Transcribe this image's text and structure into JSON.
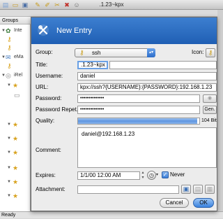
{
  "window": {
    "title": ".1.23~kpx"
  },
  "sidebar": {
    "header": "Groups",
    "items": [
      {
        "label": "Inte"
      },
      {
        "label": ""
      },
      {
        "label": ""
      },
      {
        "label": "eMa"
      },
      {
        "label": ""
      },
      {
        "label": "iRel"
      }
    ]
  },
  "status": {
    "text": "Ready"
  },
  "dialog": {
    "title": "New Entry",
    "group_label": "Group:",
    "group_value": "ssh",
    "icon_label": "Icon:",
    "title_label": "Title:",
    "title_value": ".1.23~kpx",
    "username_label": "Username:",
    "username_value": "daniel",
    "url_label": "URL:",
    "url_value": "kpx://ssh?{USERNAME}:{PASSWORD}:192.168.1.23",
    "password_label": "Password:",
    "password_value": "••••••••••••••",
    "password_repeat_label": "Password Repet.:",
    "password_repeat_value": "••••••••••••••",
    "gen_label": "Gen.",
    "quality_label": "Quality:",
    "quality_value": "104 Bit",
    "quality_fraction": 0.98,
    "comment_label": "Comment:",
    "comment_value": "daniel@192.168.1.23",
    "expires_label": "Expires:",
    "expires_value": "1/1/00 12:00 AM",
    "never_label": "Never",
    "never_checked": true,
    "attachment_label": "Attachment:",
    "attachment_value": "",
    "cancel_label": "Cancel",
    "ok_label": "OK"
  }
}
